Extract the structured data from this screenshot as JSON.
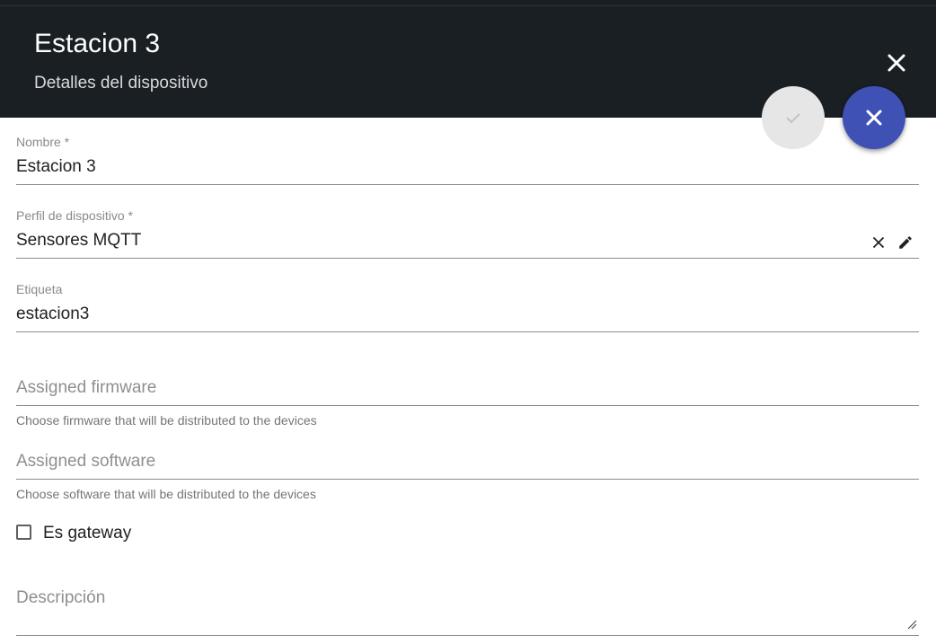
{
  "header": {
    "title": "Estacion 3",
    "subtitle": "Detalles del dispositivo",
    "close_icon": "close-icon"
  },
  "actions": {
    "save_icon": "check-icon",
    "cancel_icon": "close-icon",
    "accent_color": "#3f51b5",
    "disabled_color": "#e6e6e6"
  },
  "form": {
    "name": {
      "label": "Nombre *",
      "value": "Estacion 3"
    },
    "profile": {
      "label": "Perfil de dispositivo *",
      "value": "Sensores MQTT",
      "clear_icon": "close-icon",
      "edit_icon": "pencil-icon"
    },
    "tag": {
      "label": "Etiqueta",
      "value": "estacion3"
    },
    "firmware": {
      "placeholder": "Assigned firmware",
      "hint": "Choose firmware that will be distributed to the devices"
    },
    "software": {
      "placeholder": "Assigned software",
      "hint": "Choose software that will be distributed to the devices"
    },
    "gateway": {
      "label": "Es gateway",
      "checked": false
    },
    "description": {
      "placeholder": "Descripción",
      "resize_icon": "resize-handle-icon"
    }
  }
}
